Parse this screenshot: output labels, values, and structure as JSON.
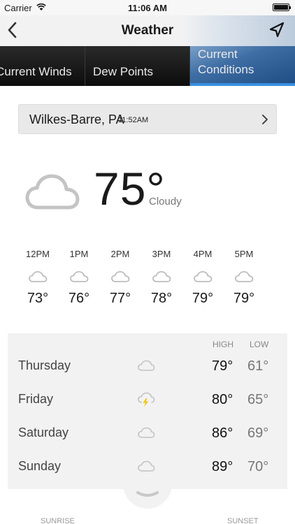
{
  "status_bar": {
    "carrier": "Carrier",
    "time": "11:06 AM"
  },
  "nav": {
    "title": "Weather"
  },
  "tabs": [
    {
      "label": "Current Winds"
    },
    {
      "label": "Dew Points"
    },
    {
      "label": "Current Conditions",
      "selected": true
    }
  ],
  "location": {
    "city": "Wilkes-Barre, PA",
    "time": "11:52AM"
  },
  "current": {
    "temp": "75°",
    "condition": "Cloudy",
    "icon": "cloud-icon"
  },
  "hourly": [
    {
      "hour": "12PM",
      "temp": "73°",
      "icon": "cloud-icon"
    },
    {
      "hour": "1PM",
      "temp": "76°",
      "icon": "cloud-icon"
    },
    {
      "hour": "2PM",
      "temp": "77°",
      "icon": "cloud-icon"
    },
    {
      "hour": "3PM",
      "temp": "78°",
      "icon": "cloud-icon"
    },
    {
      "hour": "4PM",
      "temp": "79°",
      "icon": "cloud-icon"
    },
    {
      "hour": "5PM",
      "temp": "79°",
      "icon": "cloud-icon"
    }
  ],
  "daily": {
    "high_label": "HIGH",
    "low_label": "LOW",
    "rows": [
      {
        "day": "Thursday",
        "icon": "cloud-icon",
        "high": "79°",
        "low": "61°"
      },
      {
        "day": "Friday",
        "icon": "thunderstorm-icon",
        "high": "80°",
        "low": "65°"
      },
      {
        "day": "Saturday",
        "icon": "cloud-icon",
        "high": "86°",
        "low": "69°"
      },
      {
        "day": "Sunday",
        "icon": "cloud-icon",
        "high": "89°",
        "low": "70°"
      }
    ]
  },
  "footer": {
    "sunrise_label": "SUNRISE",
    "sunset_label": "SUNSET"
  },
  "colors": {
    "accent": "#3a8fe0",
    "bolt": "#f2c200",
    "icon_gray": "#bdbdbd"
  }
}
